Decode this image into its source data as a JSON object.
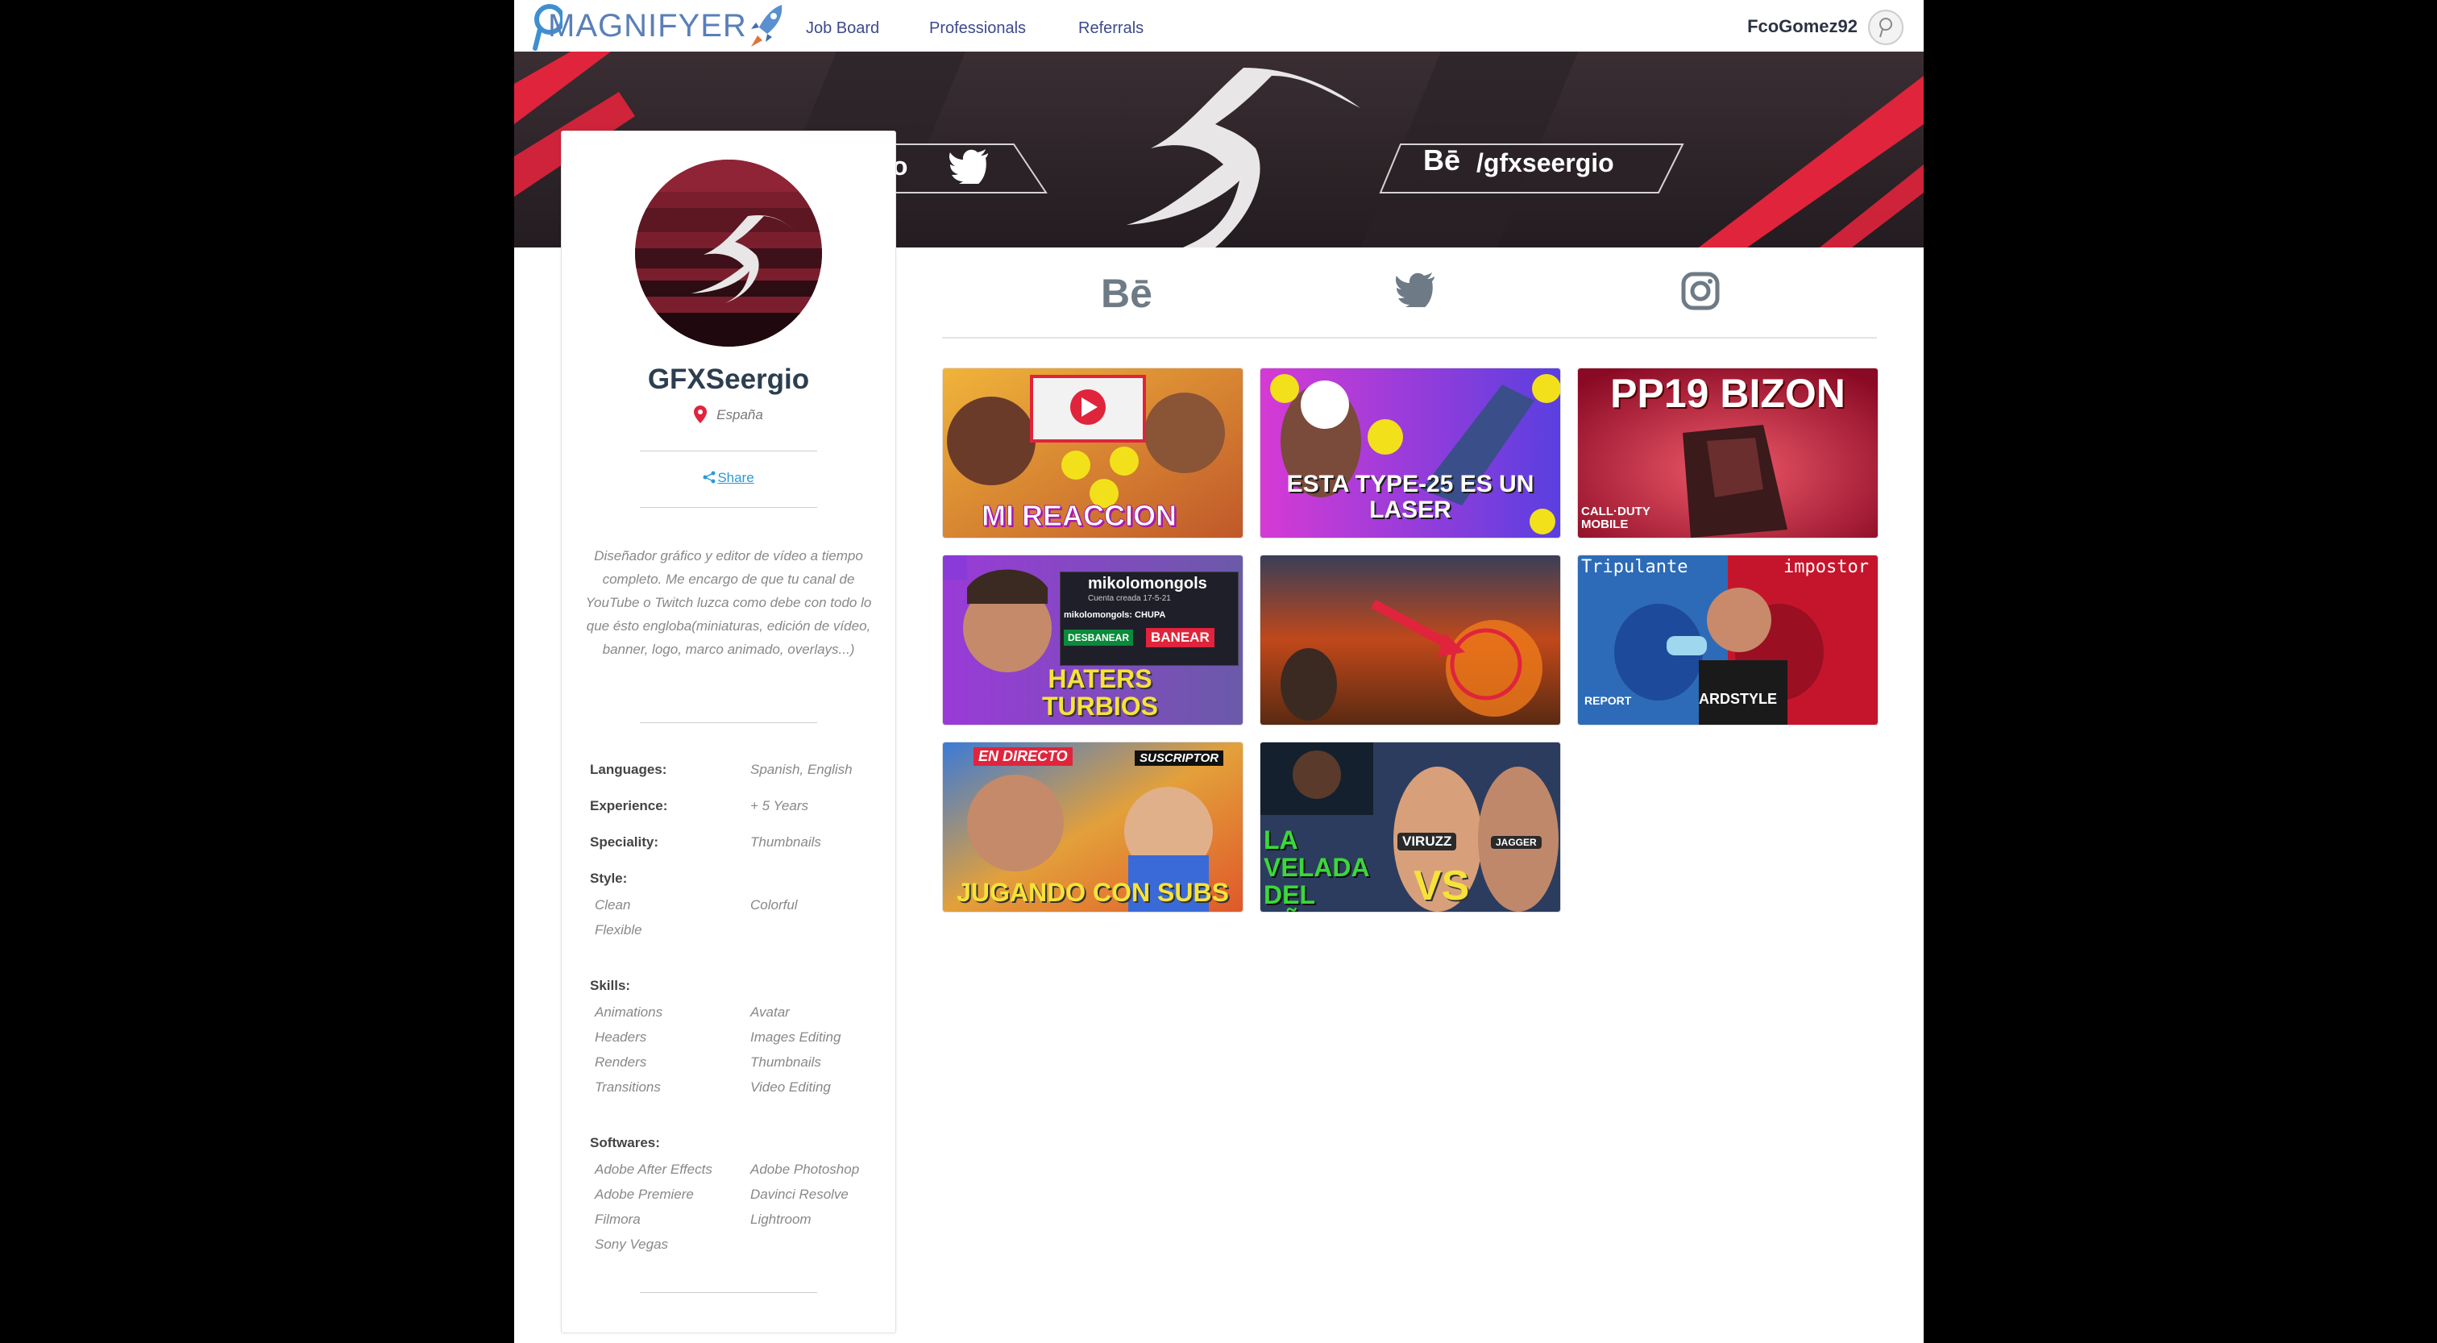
{
  "navbar": {
    "logo_text": "MAGNIFYER",
    "links": [
      "Job Board",
      "Professionals",
      "Referrals"
    ],
    "username": "FcoGomez92"
  },
  "banner": {
    "left_handle": "io",
    "right_handle": "/gfxseergio",
    "right_prefix": "Bē"
  },
  "profile": {
    "name": "GFXSeergio",
    "location": "España",
    "share_label": "Share",
    "bio": "Diseñador gráfico y editor de vídeo a tiempo completo. Me encargo de que tu canal de YouTube o Twitch luzca como debe con todo lo que ésto engloba(miniaturas, edición de vídeo, banner, logo, marco animado, overlays...)",
    "languages_label": "Languages:",
    "languages": "Spanish, English",
    "experience_label": "Experience:",
    "experience": "+ 5 Years",
    "speciality_label": "Speciality:",
    "speciality": "Thumbnails",
    "style_label": "Style:",
    "style": [
      "Clean",
      "Colorful",
      "Flexible"
    ],
    "skills_label": "Skills:",
    "skills": [
      "Animations",
      "Avatar",
      "Headers",
      "Images Editing",
      "Renders",
      "Thumbnails",
      "Transitions",
      "Video Editing"
    ],
    "softwares_label": "Softwares:",
    "softwares": [
      "Adobe After Effects",
      "Adobe Photoshop",
      "Adobe Premiere",
      "Davinci Resolve",
      "Filmora",
      "Lightroom",
      "Sony Vegas"
    ]
  },
  "social_icons": [
    "behance-icon",
    "twitter-icon",
    "instagram-icon"
  ],
  "portfolio": [
    {
      "title": "MI REACCION",
      "bg": "#d59a2a"
    },
    {
      "title": "ESTA TYPE-25 ES UN LASER",
      "bg": "#b12fd0"
    },
    {
      "title": "PP19 BIZON",
      "bg": "#c2123a",
      "subtitle": "CALL·DUTY MOBILE"
    },
    {
      "title": "HATERS TURBIOS",
      "bg": "#8d45d6",
      "overlay_name": "mikolomongols",
      "overlay_sub": "Cuenta creada 17-5-21",
      "overlay_chat": "mikolomongols: CHUPA",
      "btn1": "DESBANEAR",
      "btn2": "BANEAR"
    },
    {
      "title": "",
      "bg": "#6b3a1a"
    },
    {
      "title": "",
      "bg": "#2d6bb8",
      "top_left": "Tripulante",
      "top_right": "impostor",
      "bottom_left": "REPORT",
      "bottom_mid": "ARDSTYLE"
    },
    {
      "title": "JUGANDO CON SUBS",
      "bg": "#e36b14",
      "tag1": "EN DIRECTO",
      "tag2": "SUSCRIPTOR"
    },
    {
      "title": "LA VELADA DEL AÑO",
      "bg": "#2c3c5e",
      "tag1": "VIRUZZ",
      "tag2": "JAGGER",
      "vs": "VS"
    }
  ],
  "colors": {
    "accent": "#3d4a8c",
    "banner_red": "#e0243c",
    "share_blue": "#2b9bd6",
    "pin_red": "#e0243c"
  }
}
